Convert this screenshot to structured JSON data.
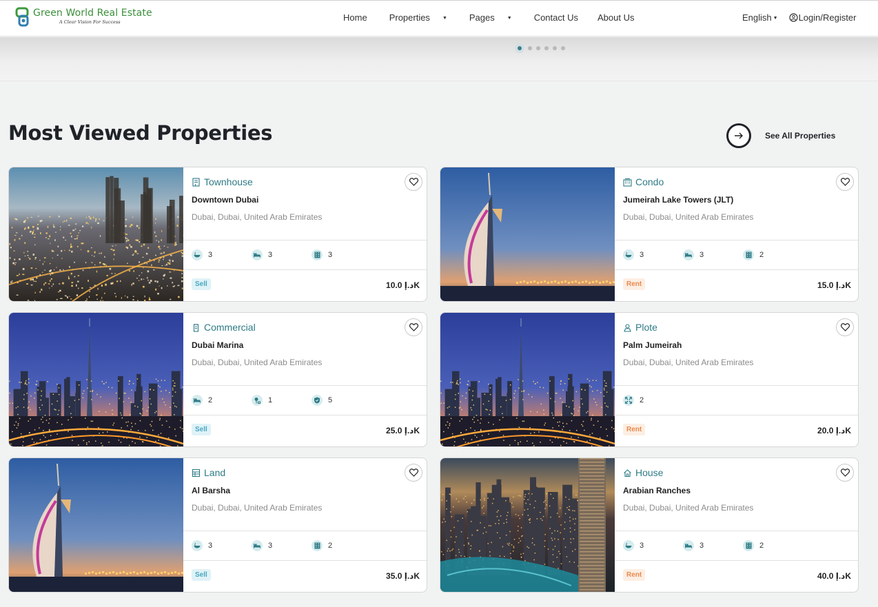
{
  "brand": {
    "title": "Green World Real Estate",
    "tagline": "A Clear Vision For Success",
    "logo_icon": "gw-logo-icon"
  },
  "nav": {
    "items": [
      {
        "label": "Home",
        "dropdown": false
      },
      {
        "label": "Properties",
        "dropdown": true
      },
      {
        "label": "Pages",
        "dropdown": true
      },
      {
        "label": "Contact Us",
        "dropdown": false
      },
      {
        "label": "About Us",
        "dropdown": false
      }
    ],
    "language": "English",
    "login": "Login/Register"
  },
  "carousel": {
    "slides": 6,
    "active": 1
  },
  "section": {
    "title": "Most Viewed Properties",
    "see_all": "See All Properties"
  },
  "colors": {
    "accent": "#2e7b86",
    "sell_badge": "#4aa7c0",
    "rent_badge": "#e88a4d"
  },
  "properties": [
    {
      "type": "Townhouse",
      "type_icon": "townhouse-icon",
      "name": "Downtown Dubai",
      "location": "Dubai, Dubai, United Arab Emirates",
      "features": [
        {
          "icon": "bathtub-icon",
          "value": "3"
        },
        {
          "icon": "bed-icon",
          "value": "3"
        },
        {
          "icon": "building-icon",
          "value": "3"
        }
      ],
      "status": "Sell",
      "price": "10.0 د.إK",
      "image": "city-night-aerial"
    },
    {
      "type": "Condo",
      "type_icon": "condo-icon",
      "name": "Jumeirah Lake Towers (JLT)",
      "location": "Dubai, Dubai, United Arab Emirates",
      "features": [
        {
          "icon": "bathtub-icon",
          "value": "3"
        },
        {
          "icon": "bed-icon",
          "value": "3"
        },
        {
          "icon": "building-icon",
          "value": "2"
        }
      ],
      "status": "Rent",
      "price": "15.0 د.إK",
      "image": "burj-al-arab"
    },
    {
      "type": "Commercial",
      "type_icon": "commercial-icon",
      "name": "Dubai Marina",
      "location": "Dubai, Dubai, United Arab Emirates",
      "features": [
        {
          "icon": "bed-icon",
          "value": "2"
        },
        {
          "icon": "parking-icon",
          "value": "1"
        },
        {
          "icon": "shield-icon",
          "value": "5"
        }
      ],
      "status": "Sell",
      "price": "25.0 د.إK",
      "image": "burj-khalifa-skyline"
    },
    {
      "type": "Plote",
      "type_icon": "plot-icon",
      "name": "Palm Jumeirah",
      "location": "Dubai, Dubai, United Arab Emirates",
      "features": [
        {
          "icon": "area-icon",
          "value": "2"
        }
      ],
      "status": "Rent",
      "price": "20.0 د.إK",
      "image": "burj-khalifa-skyline"
    },
    {
      "type": "Land",
      "type_icon": "land-icon",
      "name": "Al Barsha",
      "location": "Dubai, Dubai, United Arab Emirates",
      "features": [
        {
          "icon": "bathtub-icon",
          "value": "3"
        },
        {
          "icon": "bed-icon",
          "value": "3"
        },
        {
          "icon": "building-icon",
          "value": "2"
        }
      ],
      "status": "Sell",
      "price": "35.0 د.إK",
      "image": "burj-al-arab"
    },
    {
      "type": "House",
      "type_icon": "house-icon",
      "name": "Arabian Ranches",
      "location": "Dubai, Dubai, United Arab Emirates",
      "features": [
        {
          "icon": "bathtub-icon",
          "value": "3"
        },
        {
          "icon": "bed-icon",
          "value": "3"
        },
        {
          "icon": "building-icon",
          "value": "2"
        }
      ],
      "status": "Rent",
      "price": "40.0 د.إK",
      "image": "marina-towers"
    }
  ]
}
